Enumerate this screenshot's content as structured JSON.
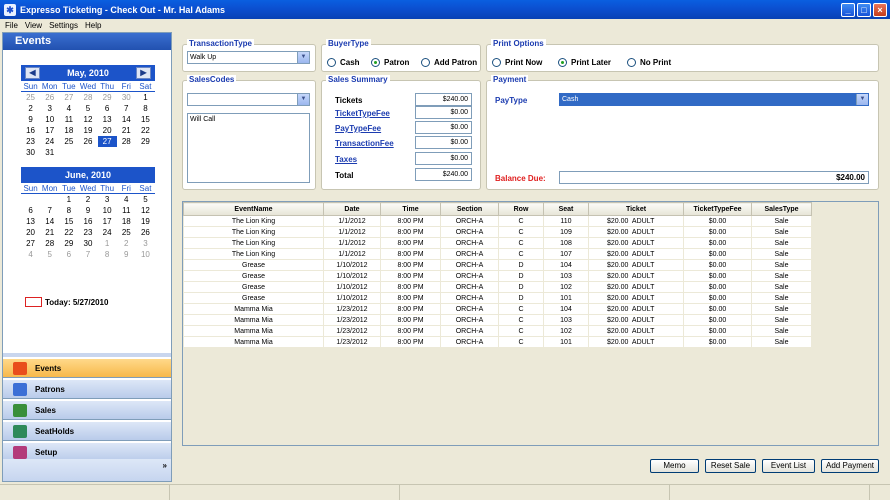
{
  "window": {
    "title": "Expresso Ticketing - Check Out - Mr. Hal Adams"
  },
  "menu": [
    "File",
    "View",
    "Settings",
    "Help"
  ],
  "sidebar": {
    "header": "Events",
    "calendars": [
      {
        "month": "May, 2010",
        "dow": [
          "Sun",
          "Mon",
          "Tue",
          "Wed",
          "Thu",
          "Fri",
          "Sat"
        ],
        "days": [
          {
            "d": "25",
            "dim": true
          },
          {
            "d": "26",
            "dim": true
          },
          {
            "d": "27",
            "dim": true
          },
          {
            "d": "28",
            "dim": true
          },
          {
            "d": "29",
            "dim": true
          },
          {
            "d": "30",
            "dim": true
          },
          {
            "d": "1"
          },
          {
            "d": "2"
          },
          {
            "d": "3"
          },
          {
            "d": "4"
          },
          {
            "d": "5"
          },
          {
            "d": "6"
          },
          {
            "d": "7"
          },
          {
            "d": "8"
          },
          {
            "d": "9"
          },
          {
            "d": "10"
          },
          {
            "d": "11"
          },
          {
            "d": "12"
          },
          {
            "d": "13"
          },
          {
            "d": "14"
          },
          {
            "d": "15"
          },
          {
            "d": "16"
          },
          {
            "d": "17"
          },
          {
            "d": "18"
          },
          {
            "d": "19"
          },
          {
            "d": "20"
          },
          {
            "d": "21"
          },
          {
            "d": "22"
          },
          {
            "d": "23"
          },
          {
            "d": "24"
          },
          {
            "d": "25"
          },
          {
            "d": "26"
          },
          {
            "d": "27",
            "sel": true
          },
          {
            "d": "28"
          },
          {
            "d": "29"
          },
          {
            "d": "30"
          },
          {
            "d": "31"
          }
        ]
      },
      {
        "month": "June, 2010",
        "dow": [
          "Sun",
          "Mon",
          "Tue",
          "Wed",
          "Thu",
          "Fri",
          "Sat"
        ],
        "days": [
          {
            "d": ""
          },
          {
            "d": ""
          },
          {
            "d": "1"
          },
          {
            "d": "2"
          },
          {
            "d": "3"
          },
          {
            "d": "4"
          },
          {
            "d": "5"
          },
          {
            "d": "6"
          },
          {
            "d": "7"
          },
          {
            "d": "8"
          },
          {
            "d": "9"
          },
          {
            "d": "10"
          },
          {
            "d": "11"
          },
          {
            "d": "12"
          },
          {
            "d": "13"
          },
          {
            "d": "14"
          },
          {
            "d": "15"
          },
          {
            "d": "16"
          },
          {
            "d": "17"
          },
          {
            "d": "18"
          },
          {
            "d": "19"
          },
          {
            "d": "20"
          },
          {
            "d": "21"
          },
          {
            "d": "22"
          },
          {
            "d": "23"
          },
          {
            "d": "24"
          },
          {
            "d": "25"
          },
          {
            "d": "26"
          },
          {
            "d": "27"
          },
          {
            "d": "28"
          },
          {
            "d": "29"
          },
          {
            "d": "30"
          },
          {
            "d": "1",
            "dim": true
          },
          {
            "d": "2",
            "dim": true
          },
          {
            "d": "3",
            "dim": true
          },
          {
            "d": "4",
            "dim": true
          },
          {
            "d": "5",
            "dim": true
          },
          {
            "d": "6",
            "dim": true
          },
          {
            "d": "7",
            "dim": true
          },
          {
            "d": "8",
            "dim": true
          },
          {
            "d": "9",
            "dim": true
          },
          {
            "d": "10",
            "dim": true
          }
        ]
      }
    ],
    "today": "Today: 5/27/2010",
    "nav": [
      {
        "label": "Events",
        "icon": "calendar-icon",
        "active": true,
        "color": "#e94e1b"
      },
      {
        "label": "Patrons",
        "icon": "patrons-icon",
        "active": false,
        "color": "#3b6fd6"
      },
      {
        "label": "Sales",
        "icon": "sales-icon",
        "active": false,
        "color": "#3a8f3a"
      },
      {
        "label": "SeatHolds",
        "icon": "seatholds-icon",
        "active": false,
        "color": "#2f8a5a"
      },
      {
        "label": "Setup",
        "icon": "setup-icon",
        "active": false,
        "color": "#b33a7a"
      }
    ],
    "more": "»"
  },
  "transaction": {
    "title": "TransactionType",
    "value": "Walk Up"
  },
  "buyer": {
    "title": "BuyerType",
    "options": [
      "Cash",
      "Patron",
      "Add Patron"
    ],
    "selected": 1
  },
  "print": {
    "title": "Print Options",
    "options": [
      "Print Now",
      "Print Later",
      "No Print"
    ],
    "selected": 1
  },
  "salescodes": {
    "title": "SalesCodes",
    "value": "",
    "list": [
      "Will Call"
    ]
  },
  "summary": {
    "title": "Sales Summary",
    "rows": [
      {
        "label": "Tickets",
        "value": "$240.00",
        "link": false
      },
      {
        "label": "TicketTypeFee",
        "value": "$0.00",
        "link": true
      },
      {
        "label": "PayTypeFee",
        "value": "$0.00",
        "link": true
      },
      {
        "label": "TransactionFee",
        "value": "$0.00",
        "link": true
      },
      {
        "label": "Taxes",
        "value": "$0.00",
        "link": true
      },
      {
        "label": "Total",
        "value": "$240.00",
        "link": false
      }
    ]
  },
  "payment": {
    "title": "Payment",
    "paytype_label": "PayType",
    "paytype": "Cash",
    "balance_label": "Balance Due:",
    "balance": "$240.00",
    "balance_color": "#e02020"
  },
  "table": {
    "headers": [
      "EventName",
      "Date",
      "Time",
      "Section",
      "Row",
      "Seat",
      "Ticket",
      "TicketTypeFee",
      "SalesType"
    ],
    "rows": [
      [
        "The Lion King",
        "1/1/2012",
        "8:00 PM",
        "ORCH-A",
        "C",
        "110",
        "$20.00  ADULT",
        "$0.00",
        "Sale"
      ],
      [
        "The Lion King",
        "1/1/2012",
        "8:00 PM",
        "ORCH-A",
        "C",
        "109",
        "$20.00  ADULT",
        "$0.00",
        "Sale"
      ],
      [
        "The Lion King",
        "1/1/2012",
        "8:00 PM",
        "ORCH-A",
        "C",
        "108",
        "$20.00  ADULT",
        "$0.00",
        "Sale"
      ],
      [
        "The Lion King",
        "1/1/2012",
        "8:00 PM",
        "ORCH-A",
        "C",
        "107",
        "$20.00  ADULT",
        "$0.00",
        "Sale"
      ],
      [
        "Grease",
        "1/10/2012",
        "8:00 PM",
        "ORCH-A",
        "D",
        "104",
        "$20.00  ADULT",
        "$0.00",
        "Sale"
      ],
      [
        "Grease",
        "1/10/2012",
        "8:00 PM",
        "ORCH-A",
        "D",
        "103",
        "$20.00  ADULT",
        "$0.00",
        "Sale"
      ],
      [
        "Grease",
        "1/10/2012",
        "8:00 PM",
        "ORCH-A",
        "D",
        "102",
        "$20.00  ADULT",
        "$0.00",
        "Sale"
      ],
      [
        "Grease",
        "1/10/2012",
        "8:00 PM",
        "ORCH-A",
        "D",
        "101",
        "$20.00  ADULT",
        "$0.00",
        "Sale"
      ],
      [
        "Mamma Mia",
        "1/23/2012",
        "8:00 PM",
        "ORCH-A",
        "C",
        "104",
        "$20.00  ADULT",
        "$0.00",
        "Sale"
      ],
      [
        "Mamma Mia",
        "1/23/2012",
        "8:00 PM",
        "ORCH-A",
        "C",
        "103",
        "$20.00  ADULT",
        "$0.00",
        "Sale"
      ],
      [
        "Mamma Mia",
        "1/23/2012",
        "8:00 PM",
        "ORCH-A",
        "C",
        "102",
        "$20.00  ADULT",
        "$0.00",
        "Sale"
      ],
      [
        "Mamma Mia",
        "1/23/2012",
        "8:00 PM",
        "ORCH-A",
        "C",
        "101",
        "$20.00  ADULT",
        "$0.00",
        "Sale"
      ]
    ]
  },
  "buttons": {
    "memo": "Memo",
    "reset": "Reset Sale",
    "eventlist": "Event List",
    "addpayment": "Add Payment"
  }
}
